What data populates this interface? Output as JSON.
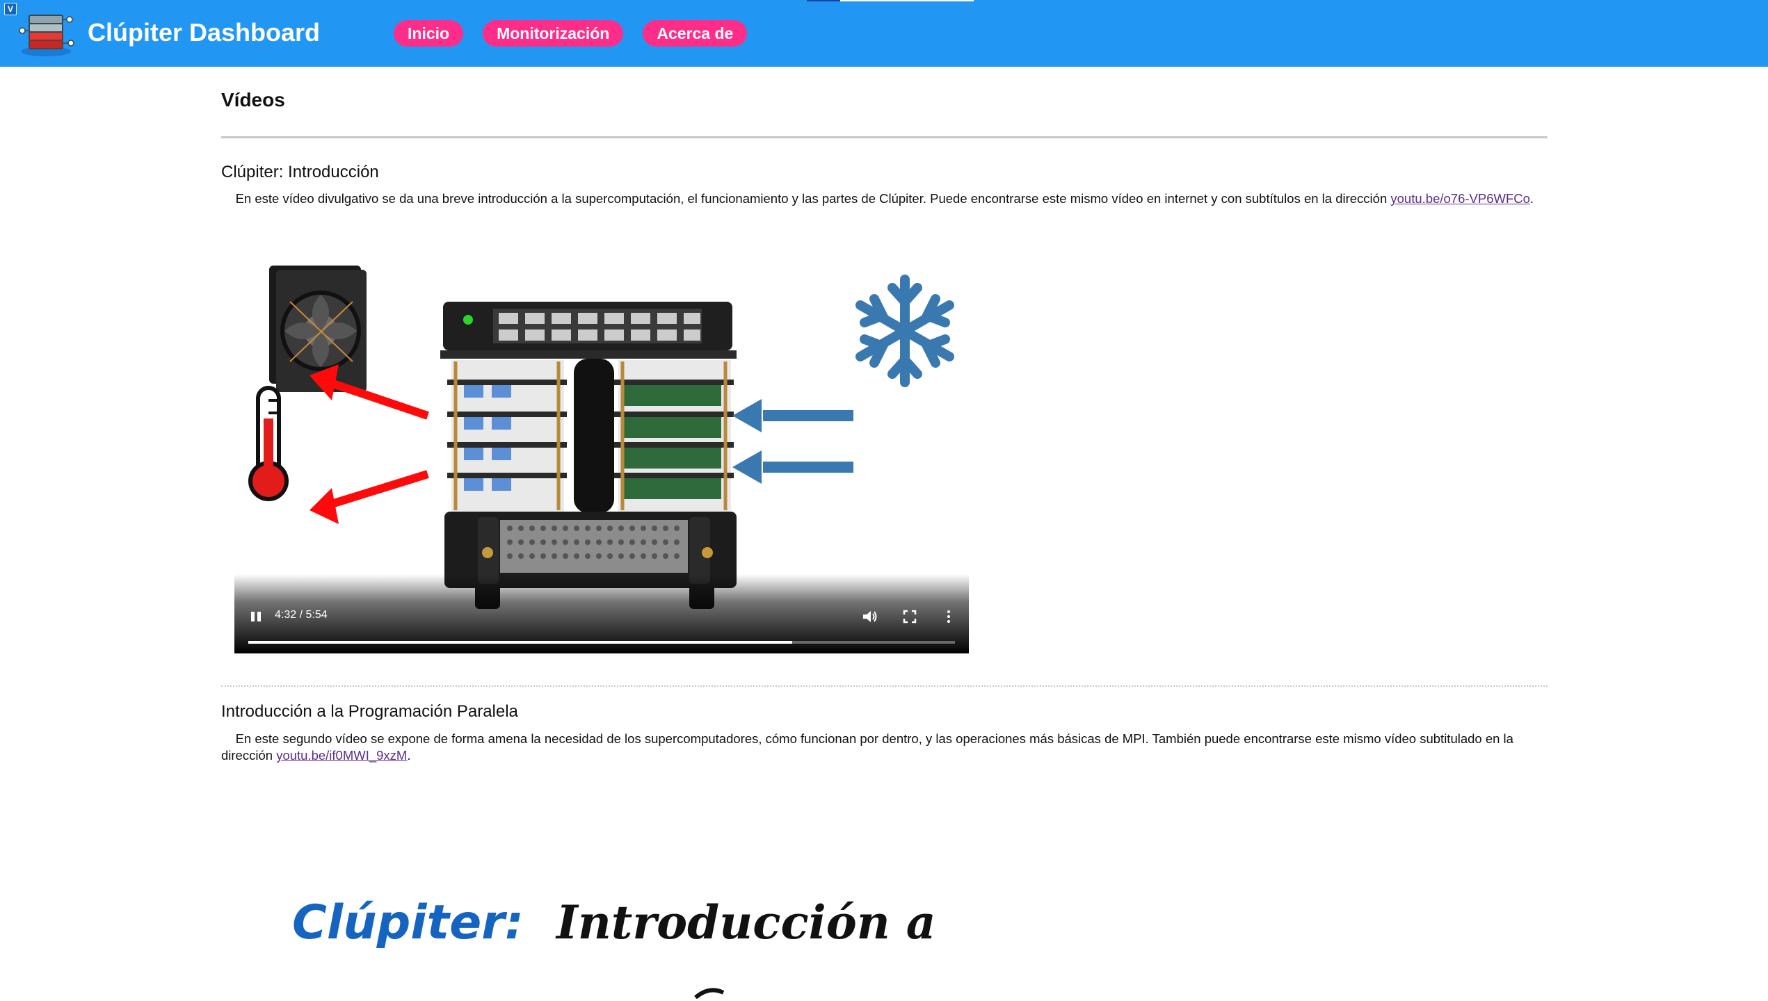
{
  "header": {
    "brand": "Clúpiter Dashboard",
    "nav": [
      {
        "label": "Inicio"
      },
      {
        "label": "Monitorización"
      },
      {
        "label": "Acerca de"
      }
    ],
    "color": "#2196f3",
    "nav_color": "#ff2d8a"
  },
  "main": {
    "section_title": "Vídeos",
    "videos": [
      {
        "title": "Clúpiter: Introducción",
        "description": "En este vídeo divulgativo se da una breve introducción a la supercomputación, el funcionamiento y las partes de Clúpiter. Puede encontrarse este mismo vídeo en internet y con subtítulos en la dirección ",
        "link": "youtu.be/o76-VP6WFCo",
        "after_link": ".",
        "player": {
          "time": "4:32 / 5:54",
          "progress_fraction": 0.77
        }
      },
      {
        "title": "Introducción a la Programación Paralela",
        "description": "En este segundo vídeo se expone de forma amena la necesidad de los supercomputadores, cómo funcionan por dentro, y las operaciones más básicas de MPI. También puede encontrarse este mismo vídeo subtitulado en la dirección ",
        "link": "youtu.be/if0MWI_9xzM",
        "after_link": ".",
        "preview_text_a": "Clúpiter:",
        "preview_text_b": "Introducción a"
      }
    ]
  }
}
